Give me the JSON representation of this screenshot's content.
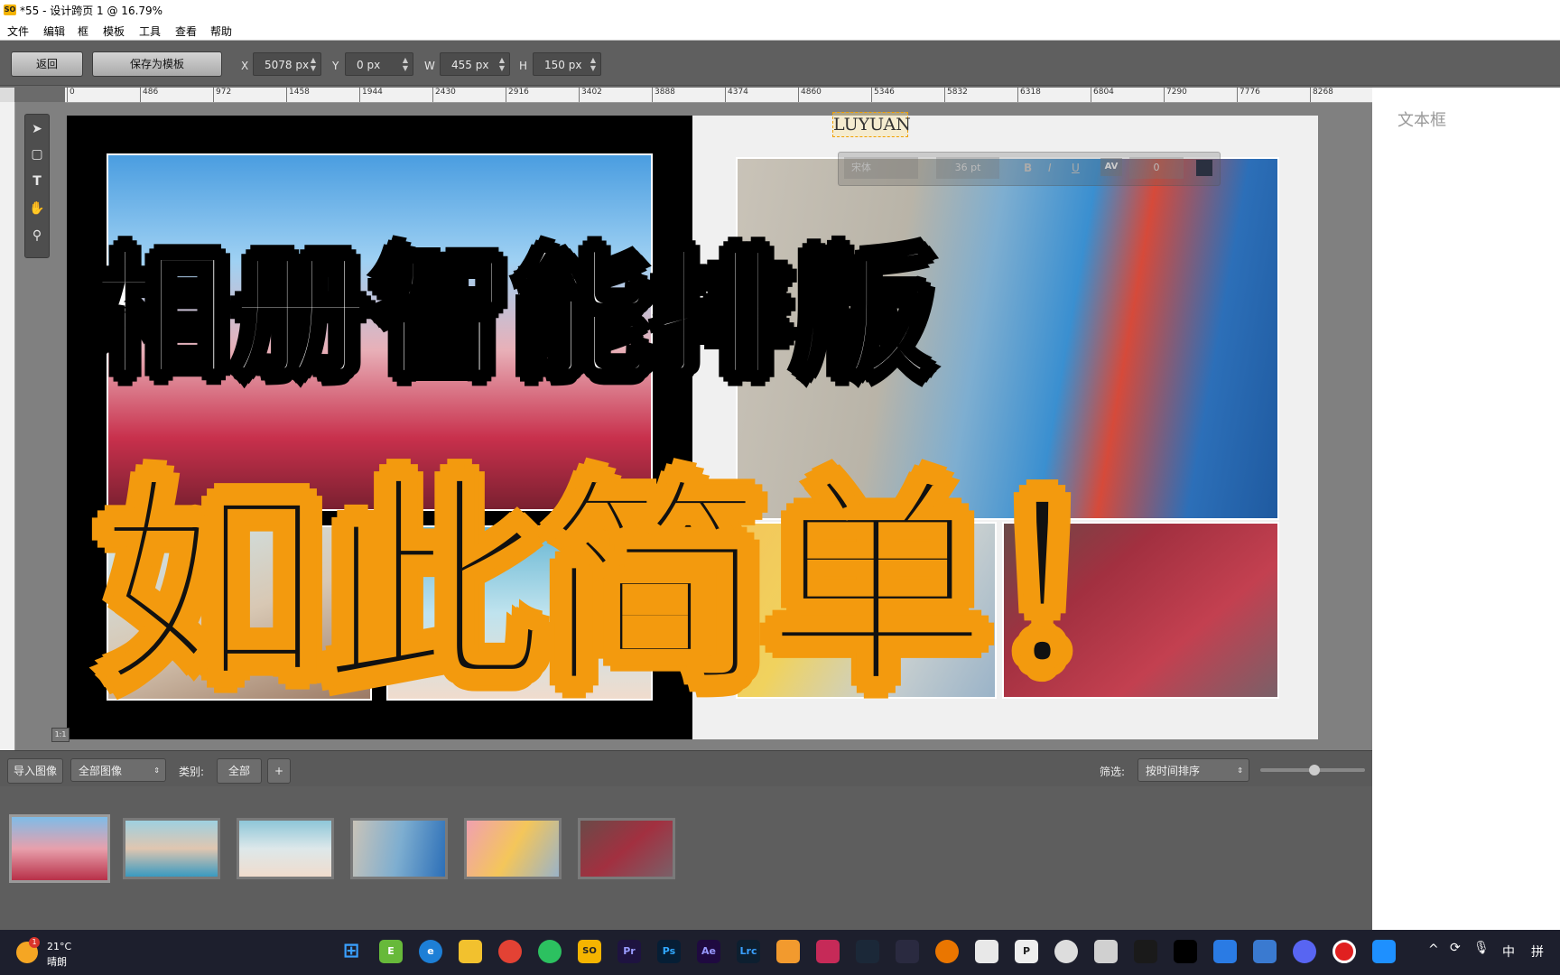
{
  "window": {
    "title": "*55 - 设计跨页 1 @ 16.79%"
  },
  "menu": [
    "文件",
    "编辑",
    "框",
    "模板",
    "工具",
    "查看",
    "帮助"
  ],
  "toolbar": {
    "back_label": "返回",
    "save_template_label": "保存为模板",
    "x_label": "X",
    "x_value": "5078 px",
    "y_label": "Y",
    "y_value": "0 px",
    "w_label": "W",
    "w_value": "455 px",
    "h_label": "H",
    "h_value": "150 px"
  },
  "ruler_ticks": [
    "0",
    "486",
    "972",
    "1458",
    "1944",
    "2430",
    "2916",
    "3402",
    "3888",
    "4374",
    "4860",
    "5346",
    "5832",
    "6318",
    "6804",
    "7290",
    "7776",
    "8268"
  ],
  "text_toolbar": {
    "font": "宋体",
    "size": "36 pt",
    "bold": "B",
    "italic": "I",
    "underline": "U",
    "tracking_icon": "AV",
    "tracking": "0"
  },
  "canvas": {
    "text_frame": "LUYUAN",
    "zoom_reset": "1:1"
  },
  "overlay": {
    "line1": "相册智能排版",
    "line2": "如此简单！"
  },
  "right_panel": {
    "title": "文本框"
  },
  "bottom_toolbar": {
    "import_label": "导入图像",
    "filter_value": "全部图像",
    "category_label": "类别:",
    "category_value": "全部",
    "add_label": "+",
    "sort_label": "筛选:",
    "sort_value": "按时间排序"
  },
  "taskbar": {
    "temperature": "21°C",
    "weather": "晴朗",
    "weather_badge": "1",
    "ime": "中",
    "ime2": "拼"
  }
}
